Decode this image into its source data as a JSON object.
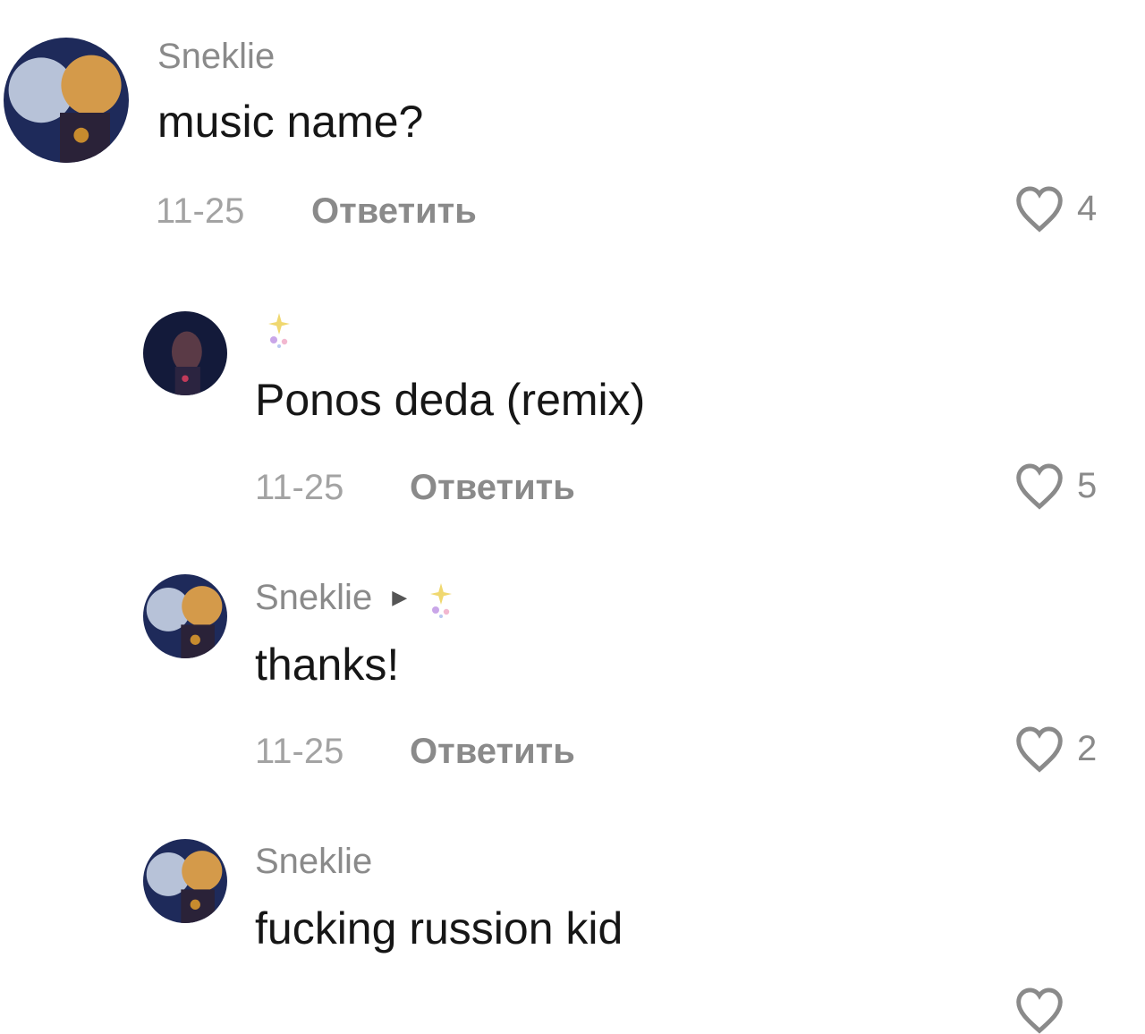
{
  "comments": [
    {
      "username": "Sneklie",
      "text": "music name?",
      "date": "11-25",
      "reply_label": "Ответить",
      "likes": "4"
    },
    {
      "username_icon": "sparkle-emoji-icon",
      "text": "Ponos deda (remix)",
      "date": "11-25",
      "reply_label": "Ответить",
      "likes": "5"
    },
    {
      "username": "Sneklie",
      "reply_to_icon": "sparkle-emoji-icon",
      "text": "thanks!",
      "date": "11-25",
      "reply_label": "Ответить",
      "likes": "2"
    },
    {
      "username": "Sneklie",
      "text": "fucking russion kid"
    }
  ],
  "icons": {
    "like": "heart-outline-icon",
    "reply_arrow": "triangle-right-icon"
  },
  "colors": {
    "username": "#8a8a8a",
    "text": "#161616",
    "meta": "#a3a3a3"
  }
}
